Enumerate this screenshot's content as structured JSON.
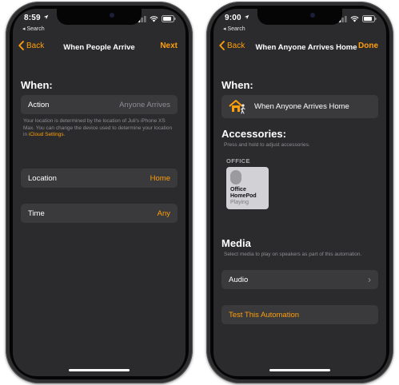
{
  "left": {
    "status": {
      "time": "8:59",
      "back_app": "◂ Search"
    },
    "nav": {
      "back": "Back",
      "title": "When People Arrive",
      "right": "Next"
    },
    "when_heading": "When:",
    "action_row": {
      "label": "Action",
      "value": "Anyone Arrives"
    },
    "footnote": {
      "text": "Your location is determined by the location of Juli's iPhone XS Max. You can change the device used to determine your location in ",
      "link": "iCloud Settings",
      "end": "."
    },
    "location_row": {
      "label": "Location",
      "value": "Home"
    },
    "time_row": {
      "label": "Time",
      "value": "Any"
    }
  },
  "right": {
    "status": {
      "time": "9:00",
      "back_app": "◂ Search"
    },
    "nav": {
      "back": "Back",
      "title": "When Anyone Arrives Home",
      "right": "Done"
    },
    "when_heading": "When:",
    "trigger_row": {
      "label": "When Anyone Arrives Home"
    },
    "accessories_heading": "Accessories:",
    "accessories_hint": "Press and hold to adjust accessories.",
    "room_label": "OFFICE",
    "tile": {
      "name_line1": "Office",
      "name_line2": "HomePod",
      "status": "Playing"
    },
    "media_heading": "Media",
    "media_hint": "Select media to play on speakers as part of this automation.",
    "audio_row": {
      "label": "Audio",
      "chevron": "›"
    },
    "test_row": {
      "label": "Test This Automation"
    }
  },
  "colors": {
    "accent": "#ff9f0a",
    "background": "#2b2b2d",
    "cell": "#3a3a3c",
    "secondary_text": "#8e8e93"
  },
  "icons": [
    "location-arrow-icon",
    "signal-bars-icon",
    "wifi-icon",
    "battery-icon",
    "chevron-left-icon",
    "home-person-icon",
    "homepod-icon",
    "chevron-right-icon"
  ]
}
